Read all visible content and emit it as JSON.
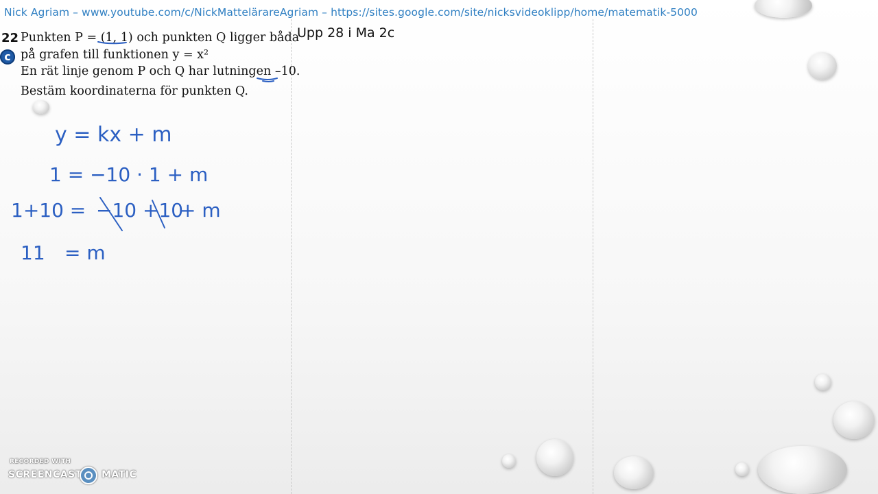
{
  "header": {
    "text": "Nick Agriam – www.youtube.com/c/NickMattelärareAgriam – https://sites.google.com/site/nicksvideoklipp/home/matematik-5000"
  },
  "task": {
    "title": "Upp 28 i Ma 2c"
  },
  "problem": {
    "number": "22",
    "level": "c",
    "line1": "Punkten P = (1, 1)  och punkten Q ligger båda",
    "line2": "på grafen till funktionen y = x²",
    "line3": "En rät linje genom P och  Q har lutningen –10.",
    "line4": "Bestäm koordinaterna för punkten Q."
  },
  "handwriting": {
    "line1": "y = kx + m",
    "line2": "1 = −10 · 1 + m",
    "line3_left": "1+10 =",
    "line3_mid": "−10 +10",
    "line3_right": "+ m",
    "line4_left": "11",
    "line4_right": "= m"
  },
  "watermark": {
    "small": "RECORDED WITH",
    "left": "SCREENCAST",
    "right": "MATIC"
  }
}
